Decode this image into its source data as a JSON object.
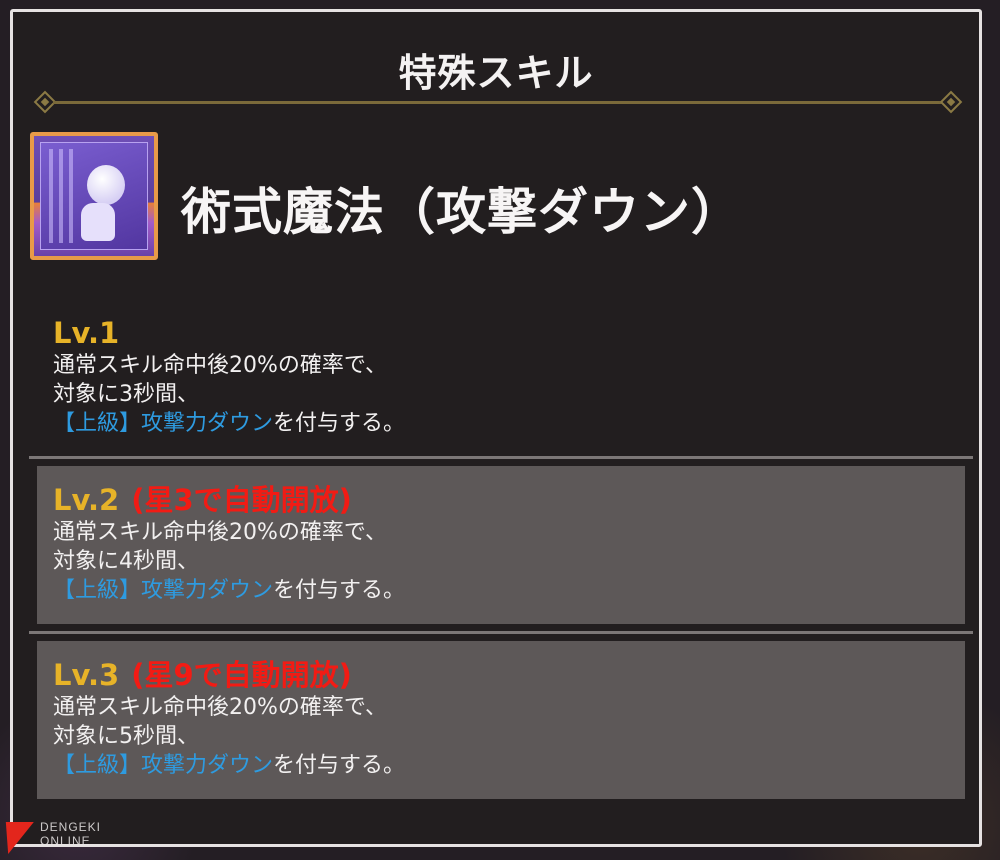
{
  "panel": {
    "title": "特殊スキル"
  },
  "skill": {
    "name": "術式魔法（攻撃ダウン）"
  },
  "levels": [
    {
      "label": "Lv.1",
      "unlock": "",
      "line1": "通常スキル命中後20%の確率で、",
      "line2": "対象に3秒間、",
      "effect_bracket": "【上級】",
      "effect_keyword": "攻撃力ダウン",
      "effect_tail": "を付与する。"
    },
    {
      "label": "Lv.2",
      "unlock": "(星3で自動開放)",
      "line1": "通常スキル命中後20%の確率で、",
      "line2": "対象に4秒間、",
      "effect_bracket": "【上級】",
      "effect_keyword": "攻撃力ダウン",
      "effect_tail": "を付与する。"
    },
    {
      "label": "Lv.3",
      "unlock": "(星9で自動開放)",
      "line1": "通常スキル命中後20%の確率で、",
      "line2": "対象に5秒間、",
      "effect_bracket": "【上級】",
      "effect_keyword": "攻撃力ダウン",
      "effect_tail": "を付与する。"
    }
  ],
  "watermark": {
    "line1": "DENGEKI",
    "line2": "ONLINE"
  },
  "colors": {
    "level_label": "#e7b328",
    "unlock_text": "#f21b14",
    "effect_keyword": "#2e9be0",
    "locked_row_bg": "#5d5858"
  }
}
